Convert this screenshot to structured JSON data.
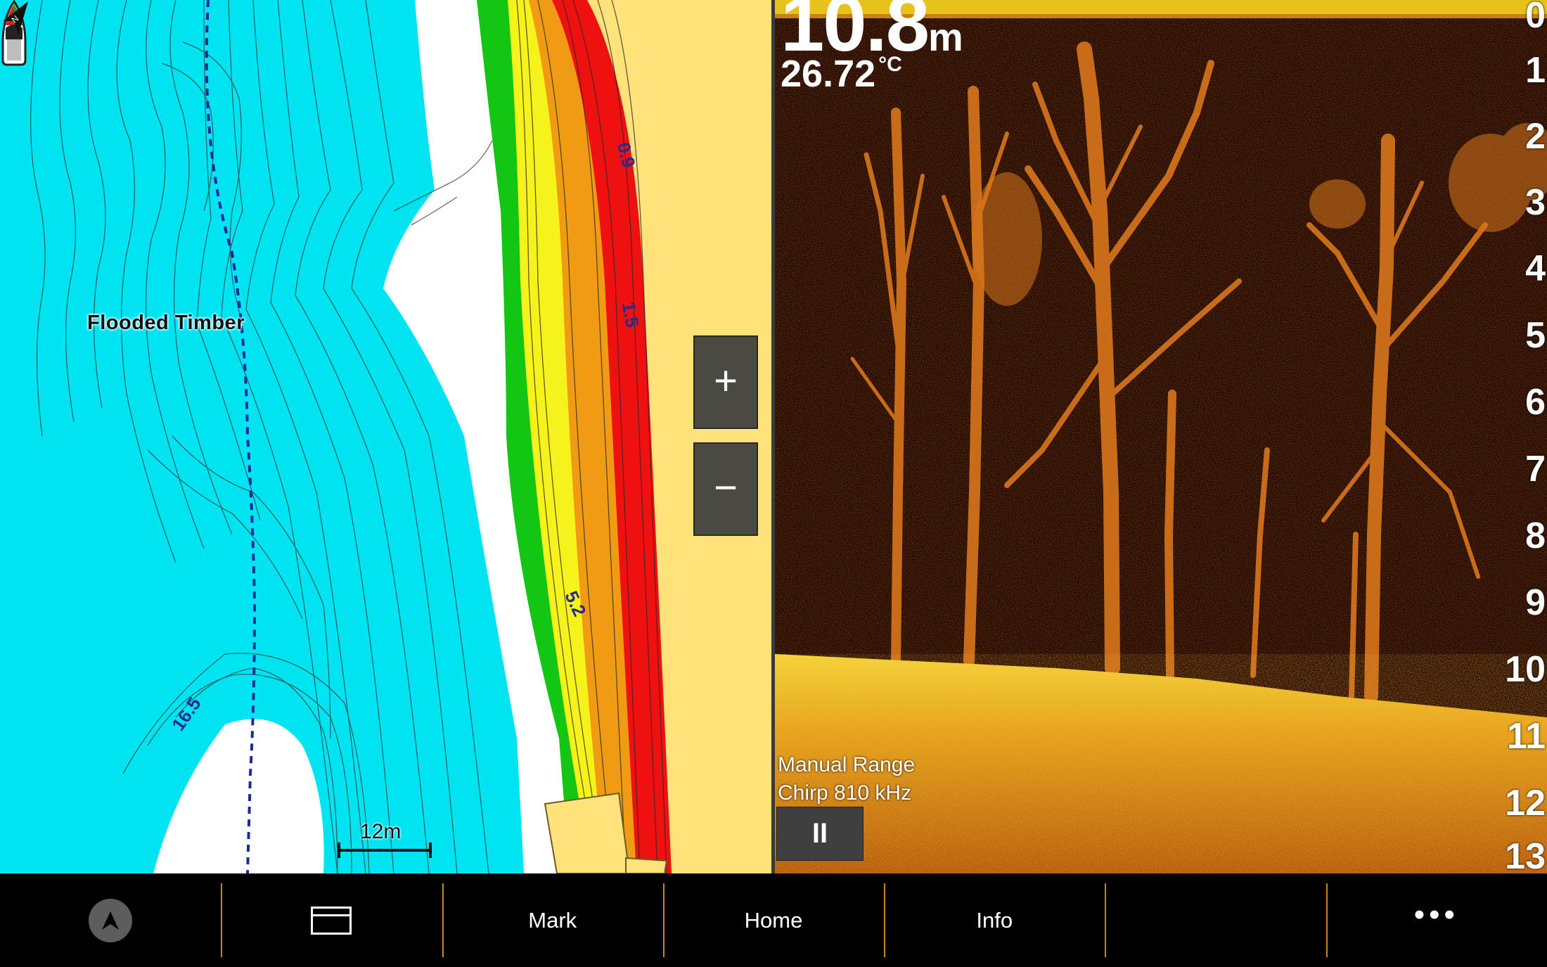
{
  "chart": {
    "area_label": "Flooded Timber",
    "depth_labels": [
      "0.9",
      "1.5",
      "5.2",
      "16.5"
    ],
    "scale_label": "12m",
    "zoom_in_label": "+",
    "zoom_out_label": "−",
    "colors": {
      "deep_water": "#00e4f2",
      "shallow_white": "#ffffff",
      "green": "#13c613",
      "yellow": "#f6f21c",
      "orange": "#f19a14",
      "red": "#ef1010",
      "land": "#ffe27a"
    }
  },
  "sonar": {
    "depth_value": "10.8",
    "depth_unit": "m",
    "temperature_value": "26.72",
    "temperature_unit": "°C",
    "depth_scale": [
      "0",
      "1",
      "2",
      "3",
      "4",
      "5",
      "6",
      "7",
      "8",
      "9",
      "10",
      "11",
      "12",
      "13"
    ],
    "mode_line1": "Manual Range",
    "mode_line2": "Chirp 810 kHz",
    "pause_label": "II"
  },
  "bottom_bar": {
    "items": [
      {
        "type": "icon",
        "icon": "navigation-icon"
      },
      {
        "type": "icon",
        "icon": "layout-icon"
      },
      {
        "type": "text",
        "label": "Mark"
      },
      {
        "type": "text",
        "label": "Home"
      },
      {
        "type": "text",
        "label": "Info"
      },
      {
        "type": "blank",
        "label": ""
      },
      {
        "type": "icon",
        "icon": "more-options-icon",
        "label": "•••"
      }
    ]
  }
}
